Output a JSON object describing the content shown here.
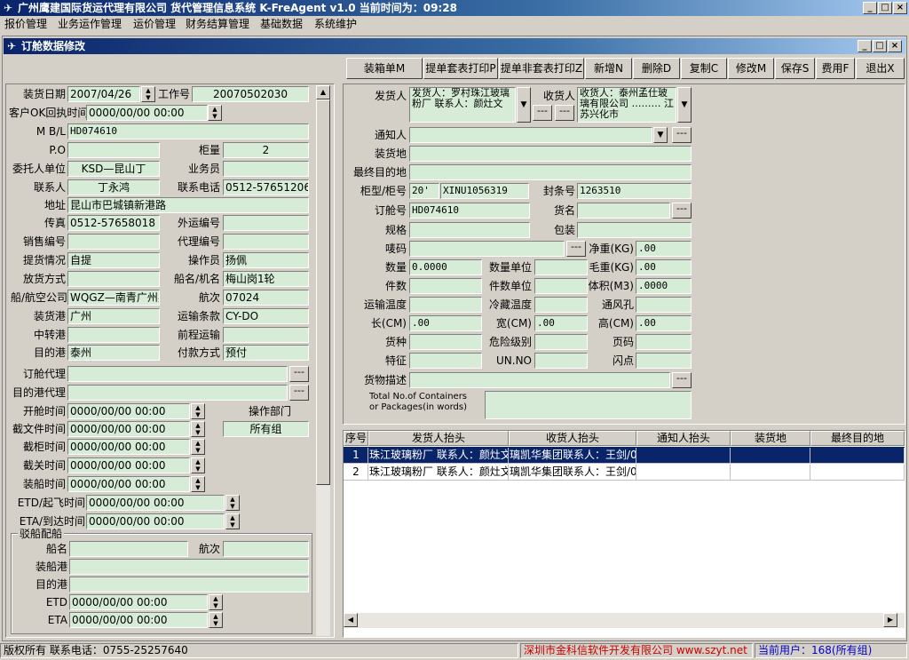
{
  "window": {
    "title": "广州鹰建国际货运代理有限公司  货代管理信息系统 K-FreAgent v1.0  当前时间为：09:28"
  },
  "menu": [
    "报价管理",
    "业务运作管理",
    "运价管理",
    "财务结算管理",
    "基础数据",
    "系统维护"
  ],
  "subwindow": {
    "title": "订舱数据修改"
  },
  "toolbar": [
    {
      "label": "装箱单M",
      "name": "packing-list-button"
    },
    {
      "label": "提单套表打印P",
      "name": "print-bl-set-button"
    },
    {
      "label": "提单非套表打印Z",
      "name": "print-bl-nonset-button"
    },
    {
      "label": "新增N",
      "name": "new-button"
    },
    {
      "label": "删除D",
      "name": "delete-button"
    },
    {
      "label": "复制C",
      "name": "copy-button"
    },
    {
      "label": "修改M",
      "name": "edit-button"
    },
    {
      "label": "保存S",
      "name": "save-button"
    },
    {
      "label": "费用F",
      "name": "fee-button"
    },
    {
      "label": "退出X",
      "name": "exit-button"
    }
  ],
  "left": {
    "load_date_label": "装货日期",
    "load_date": "2007/04/26",
    "job_no_label": "工作号",
    "job_no": "20070502030",
    "ok_time_label": "客户OK回执时间",
    "ok_time": "0000/00/00 00:00",
    "mbl_label": "M B/L",
    "mbl": "HD074610",
    "po_label": "P.O",
    "po": "",
    "container_count_label": "柜量",
    "container_count": "2",
    "client_label": "委托人单位",
    "client": "KSD—昆山丁",
    "salesman_label": "业务员",
    "salesman": "",
    "contact_label": "联系人",
    "contact": "丁永鸿",
    "phone_label": "联系电话",
    "phone": "0512-57651206/",
    "address_label": "地址",
    "address": "昆山市巴城镇新港路",
    "fax_label": "传真",
    "fax": "0512-57658018",
    "ext_no_label": "外运编号",
    "ext_no": "",
    "sales_no_label": "销售编号",
    "sales_no": "",
    "agent_no_label": "代理编号",
    "agent_no": "",
    "pickup_label": "提货情况",
    "pickup": "自提",
    "operator_label": "操作员",
    "operator": "扬佩",
    "release_label": "放货方式",
    "release": "",
    "vessel_label": "船名/机名",
    "vessel": "梅山岗1轮",
    "carrier_label": "船/航空公司",
    "carrier": "WQGZ—南青广州办",
    "voyage_label": "航次",
    "voyage": "07024",
    "pol_label": "装货港",
    "pol": "广州",
    "terms_label": "运输条款",
    "terms": "CY-DO",
    "transit_label": "中转港",
    "transit": "",
    "pre_carriage_label": "前程运输",
    "pre_carriage": "",
    "pod_label": "目的港",
    "pod": "泰州",
    "payment_label": "付款方式",
    "payment": "预付",
    "booking_agent_label": "订舱代理",
    "booking_agent": "",
    "dest_agent_label": "目的港代理",
    "dest_agent": "",
    "open_time_label": "开舱时间",
    "open_time": "0000/00/00 00:00",
    "dept_label": "操作部门",
    "doc_cutoff_label": "截文件时间",
    "doc_cutoff": "0000/00/00 00:00",
    "dept": "所有组",
    "cy_cutoff_label": "截柜时间",
    "cy_cutoff": "0000/00/00 00:00",
    "customs_cutoff_label": "截关时间",
    "customs_cutoff": "0000/00/00  00:00",
    "loading_time_label": "装船时间",
    "loading_time": "0000/00/00 00:00",
    "etd_label": "ETD/起飞时间",
    "etd": "0000/00/00  00:00",
    "eta_label": "ETA/到达时间",
    "eta": "0000/00/00  00:00",
    "feeder_group_label": "驳船配船",
    "f_vessel_label": "船名",
    "f_vessel": "",
    "f_voyage_label": "航次",
    "f_voyage": "",
    "f_pol_label": "装船港",
    "f_pol": "",
    "f_pod_label": "目的港",
    "f_pod": "",
    "f_etd_label": "ETD",
    "f_etd": "0000/00/00 00:00",
    "f_eta_label": "ETA",
    "f_eta": "0000/00/00 00:00"
  },
  "right": {
    "shipper_label": "发货人",
    "shipper": "发货人：罗村珠江玻璃粉厂 联系人：颜灶文",
    "consignee_label": "收货人",
    "consignee": "收货人：泰州孟仕玻璃有限公司 ……… 江苏兴化市",
    "notify_label": "通知人",
    "notify": "",
    "place_receipt_label": "装货地",
    "place_receipt": "",
    "final_dest_label": "最终目的地",
    "final_dest": "",
    "ctype_label": "柜型/柜号",
    "ctype": "20'",
    "cno": "XINU1056319",
    "seal_label": "封条号",
    "seal": "1263510",
    "booking_no_label": "订舱号",
    "booking_no": "HD074610",
    "goods_label": "货名",
    "goods": "",
    "spec_label": "规格",
    "spec": "",
    "pack_label": "包装",
    "pack": "",
    "marks_label": "唛码",
    "marks": "",
    "net_label": "净重(KG)",
    "net": ".00",
    "qty_label": "数量",
    "qty": "0.0000",
    "qty_unit_label": "数量单位",
    "qty_unit": "",
    "gross_label": "毛重(KG)",
    "gross": ".00",
    "pieces_label": "件数",
    "pieces": "",
    "pieces_unit_label": "件数单位",
    "pieces_unit": "",
    "volume_label": "体积(M3)",
    "volume": ".0000",
    "ship_temp_label": "运输温度",
    "ship_temp": "",
    "cold_temp_label": "冷藏温度",
    "cold_temp": "",
    "vent_label": "通风孔",
    "vent": "",
    "length_label": "长(CM)",
    "length": ".00",
    "width_label": "宽(CM)",
    "width": ".00",
    "height_label": "高(CM)",
    "height": ".00",
    "cargo_type_label": "货种",
    "cargo_type": "",
    "danger_label": "危险级别",
    "danger": "",
    "page_label": "页码",
    "page": "",
    "feature_label": "特征",
    "feature": "",
    "unno_label": "UN.NO",
    "unno": "",
    "flash_label": "闪点",
    "flash": "",
    "desc_label": "货物描述",
    "desc": "",
    "total_label_1": "Total No.of Containers",
    "total_label_2": "or Packages(in words)",
    "total": ""
  },
  "grid": {
    "columns": [
      "序号",
      "发货人抬头",
      "收货人抬头",
      "通知人抬头",
      "装货地",
      "最终目的地"
    ],
    "rows": [
      [
        "1",
        "珠江玻璃粉厂 联系人：颜灶文",
        "璃凯华集团联系人：王剑/0",
        "",
        "",
        ""
      ],
      [
        "2",
        "珠江玻璃粉厂 联系人：颜灶文",
        "璃凯华集团联系人：王剑/0",
        "",
        "",
        ""
      ]
    ]
  },
  "status": {
    "copyright": "版权所有  联系电话：0755-25257640",
    "company": "深圳市金科信软件开发有限公司  www.szyt.net",
    "user": "当前用户：168(所有组)"
  },
  "colors": {
    "field_bg": "#d7ecd7",
    "title_blue": "#0a246a",
    "selection": "#0a246a",
    "status_red": "#cc0000",
    "status_blue": "#0000cc"
  }
}
